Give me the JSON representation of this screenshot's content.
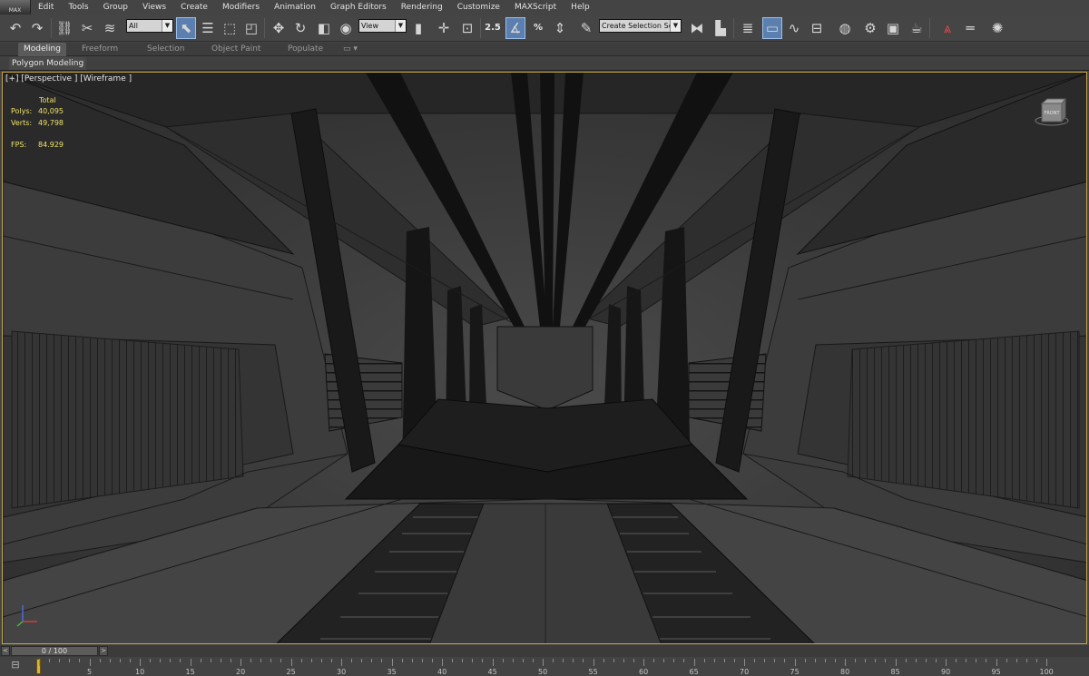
{
  "app": {
    "logo_text": "MAX"
  },
  "menu": [
    "Edit",
    "Tools",
    "Group",
    "Views",
    "Create",
    "Modifiers",
    "Animation",
    "Graph Editors",
    "Rendering",
    "Customize",
    "MAXScript",
    "Help"
  ],
  "toolbar": {
    "selection_filter": "All",
    "reference_coordinate": "View",
    "named_selection_placeholder": "Create Selection Se",
    "snap_toggle_label": "2.5",
    "percent_snap_label": "%"
  },
  "ribbon": {
    "tabs": [
      "Modeling",
      "Freeform",
      "Selection",
      "Object Paint",
      "Populate"
    ],
    "active_tab": "Modeling",
    "subtab": "Polygon Modeling"
  },
  "viewport": {
    "label": "[+] [Perspective ] [Wireframe ]",
    "stats": {
      "header": "Total",
      "polys_label": "Polys:",
      "polys_value": "40,095",
      "verts_label": "Verts:",
      "verts_value": "49,798",
      "fps_label": "FPS:",
      "fps_value": "84.929"
    },
    "viewcube_label": "FRONT"
  },
  "timeline": {
    "frame_display": "0 / 100",
    "prev_label": "<",
    "next_label": ">",
    "current_frame": 0,
    "ticks": [
      "5",
      "10",
      "15",
      "20",
      "25",
      "30",
      "35",
      "40",
      "45",
      "50",
      "55",
      "60",
      "65",
      "70",
      "75",
      "80",
      "85",
      "90",
      "95",
      "100"
    ]
  },
  "colors": {
    "accent_active": "#5b7fae",
    "stats_text": "#f0e26a",
    "viewport_border": "#c8a84a",
    "key_marker": "#d9b33a"
  }
}
